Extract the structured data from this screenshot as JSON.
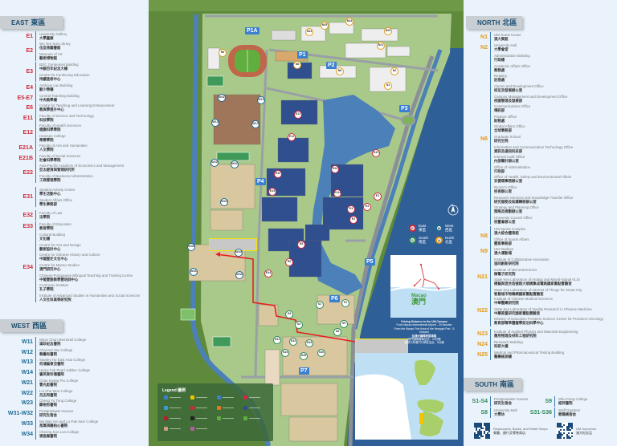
{
  "colors": {
    "east": "#d3283a",
    "west": "#1e6b94",
    "north": "#e59a16",
    "south": "#2e8a5a",
    "parking": "#3a7fd0",
    "route": "#e82020"
  },
  "east": {
    "title": "EAST",
    "title_zh": "東區",
    "groups": [
      {
        "code": "E1",
        "items": [
          {
            "en": "University Gallery",
            "zh": "大學畫廊"
          }
        ]
      },
      {
        "code": "E2",
        "items": [
          {
            "en": "Wu Yee Sun Library",
            "zh": "伍宜孫圖書館"
          },
          {
            "en": "Museum of Art",
            "zh": "藝術博物館"
          }
        ]
      },
      {
        "code": "E3",
        "items": [
          {
            "en": "BOC Centennial Building",
            "zh": "中銀百年紀念大樓"
          },
          {
            "en": "Centre for Continuing Education",
            "zh": "持續進修中心"
          }
        ]
      },
      {
        "code": "E4",
        "items": [
          {
            "en": "Anthony Lau Building",
            "zh": "劉少榮樓"
          }
        ]
      },
      {
        "code": "E5-E7",
        "items": [
          {
            "en": "Central Teaching Building",
            "zh": "中央教學樓"
          }
        ]
      },
      {
        "code": "E6",
        "items": [
          {
            "en": "Centre for Teaching and Learning Enhancement",
            "zh": "教與學提升中心"
          }
        ]
      },
      {
        "code": "E11",
        "items": [
          {
            "en": "Faculty of Science and Technology",
            "zh": "科技學院"
          }
        ]
      },
      {
        "code": "E12",
        "items": [
          {
            "en": "Faculty of Health Sciences",
            "zh": "健康科學學院"
          },
          {
            "en": "Honours College",
            "zh": "榮譽學院"
          }
        ]
      },
      {
        "code": "E21A",
        "items": [
          {
            "en": "Faculty of Arts and Humanities",
            "zh": "人文學院"
          }
        ]
      },
      {
        "code": "E21B",
        "items": [
          {
            "en": "Faculty of Social Sciences",
            "zh": "社會科學學院"
          }
        ]
      },
      {
        "code": "E22",
        "items": [
          {
            "en": "Asia-Pacific Academy of Economics and Management",
            "zh": "亞太經濟與管理研究所"
          },
          {
            "en": "Faculty of Business Administration",
            "zh": "工商管理學院"
          }
        ]
      },
      {
        "code": "E31",
        "items": [
          {
            "en": "Student Activity Centre",
            "zh": "學生活動中心"
          },
          {
            "en": "Student Affairs Office",
            "zh": "學生事務部"
          }
        ]
      },
      {
        "code": "E32",
        "items": [
          {
            "en": "Faculty of Law",
            "zh": "法學院"
          }
        ]
      },
      {
        "code": "E33",
        "items": [
          {
            "en": "Faculty of Education",
            "zh": "教育學院"
          }
        ]
      },
      {
        "code": "E34",
        "items": [
          {
            "en": "Cultural Building",
            "zh": "文化樓"
          },
          {
            "en": "Centre for Arts and Design",
            "zh": "藝術設計中心"
          },
          {
            "en": "Centre for Chinese History and Culture",
            "zh": "中國歷史文化中心"
          },
          {
            "en": "Centre for Macau Studies",
            "zh": "澳門研究中心"
          },
          {
            "en": "Chinese-Portuguese Bilingual Teaching and Training Centre",
            "zh": "中葡雙語教學暨培訓中心"
          },
          {
            "en": "Confucius Institute",
            "zh": "孔子學院"
          },
          {
            "en": "Institute of Advanced Studies in Humanities and Social Sciences",
            "zh": "人文社科高等研究院"
          }
        ]
      }
    ]
  },
  "west": {
    "title": "WEST",
    "title_zh": "西區",
    "groups": [
      {
        "code": "W11",
        "items": [
          {
            "en": "Moon Chun Memorial College",
            "zh": "滿珍紀念書院"
          }
        ]
      },
      {
        "code": "W12",
        "items": [
          {
            "en": "Choi Kai Yau College",
            "zh": "蔡繼有書院"
          }
        ]
      },
      {
        "code": "W13",
        "items": [
          {
            "en": "Stanley Ho East Asia College",
            "zh": "何鴻燊東亞書院"
          }
        ]
      },
      {
        "code": "W14",
        "items": [
          {
            "en": "Henry Fok Pearl Jubilee College",
            "zh": "霍英東珍禧書院"
          }
        ]
      },
      {
        "code": "W21",
        "items": [
          {
            "en": "Chao Kuang Piu College",
            "zh": "曹光彪書院"
          }
        ]
      },
      {
        "code": "W22",
        "items": [
          {
            "en": "Lui Che Woo College",
            "zh": "呂志和書院"
          }
        ]
      },
      {
        "code": "W23",
        "items": [
          {
            "en": "Cheng Yu Tung College",
            "zh": "鄭裕彤書院"
          }
        ]
      },
      {
        "code": "W31-W32",
        "items": [
          {
            "en": "Postgraduate Houses",
            "zh": "研究生宿舍"
          }
        ]
      },
      {
        "code": "W33",
        "items": [
          {
            "en": "Ma Man Kei and Lo Pak Sam College",
            "zh": "馬萬祺羅柏心書院"
          }
        ]
      },
      {
        "code": "W34",
        "items": [
          {
            "en": "Cheong Kun Lun College",
            "zh": "張崑崙書院"
          }
        ]
      }
    ]
  },
  "north": {
    "title": "NORTH",
    "title_zh": "北區",
    "groups": [
      {
        "code": "N1",
        "items": [
          {
            "en": "UM Guest House",
            "zh": "澳大賓館"
          }
        ]
      },
      {
        "code": "N2",
        "items": [
          {
            "en": "University Hall",
            "zh": "大學會堂"
          }
        ]
      },
      {
        "code": "N6",
        "items": [
          {
            "en": "Administration Building",
            "zh": "行政樓"
          },
          {
            "en": "Academic Affairs Office",
            "zh": "教務處"
          },
          {
            "en": "Registry",
            "zh": "註冊處"
          },
          {
            "en": "Alumni and Development Office",
            "zh": "校友及發展辦公室"
          },
          {
            "en": "Campus Management and Development Office",
            "zh": "校園管理及發展部"
          },
          {
            "en": "Communications Office",
            "zh": "傳訊部"
          },
          {
            "en": "Finance Office",
            "zh": "財務處"
          },
          {
            "en": "Global Affairs Office",
            "zh": "全球事務部"
          },
          {
            "en": "Graduate School",
            "zh": "研究生院"
          },
          {
            "en": "Information and Communication Technology Office",
            "zh": "資訊及通訊科技部"
          },
          {
            "en": "Internal Audit Office",
            "zh": "內部審計辦公室"
          },
          {
            "en": "Office of Administration",
            "zh": "行政部"
          },
          {
            "en": "Office of Health, Safety and Environmental Affairs",
            "zh": "安健環事務辦公室"
          },
          {
            "en": "Rector's Office",
            "zh": "校長辦公室"
          },
          {
            "en": "Research Services and Knowledge Transfer Office",
            "zh": "研究服務及知識轉移辦公室"
          },
          {
            "en": "Strategy and Planning Office",
            "zh": "策略及規劃辦公室"
          },
          {
            "en": "University Council Office",
            "zh": "校董會辦公室"
          }
        ]
      },
      {
        "code": "N8",
        "items": [
          {
            "en": "UM Sports Complex",
            "zh": "澳大綜合體育館"
          },
          {
            "en": "Office of Sports Affairs",
            "zh": "體育事務部"
          }
        ]
      },
      {
        "code": "N9",
        "items": [
          {
            "en": "UM Stadium",
            "zh": "澳大運動場"
          }
        ]
      },
      {
        "code": "N21",
        "items": [
          {
            "en": "Institute of Collaborative Innovation",
            "zh": "協同創新研究院"
          },
          {
            "en": "Institute of Microelectronics",
            "zh": "微電子研究院"
          },
          {
            "en": "State Key Laboratory of Analog and Mixed-Signal VLSI",
            "zh": "模擬與混合信號超大規模集成電路國家重點實驗室"
          },
          {
            "en": "State Key Laboratory of Internet of Things for Smart City",
            "zh": "智慧城市物聯網國家重點實驗室"
          }
        ]
      },
      {
        "code": "N22",
        "items": [
          {
            "en": "Institute of Chinese Medical Sciences",
            "zh": "中華醫藥研究院"
          },
          {
            "en": "State Key Laboratory of Quality Research in Chinese Medicine",
            "zh": "中藥質量研究國家重點實驗室"
          },
          {
            "en": "Ministry of Education Frontiers Science Center for Precision Oncology",
            "zh": "教育部精準腫瘤學前沿科學中心"
          }
        ]
      },
      {
        "code": "N23",
        "items": [
          {
            "en": "Institute of Applied Physics and Materials Engineering",
            "zh": "應用物理及材料工程研究院"
          }
        ]
      },
      {
        "code": "N24",
        "items": [
          {
            "en": "Research Building",
            "zh": "科研大樓"
          }
        ]
      },
      {
        "code": "N25",
        "items": [
          {
            "en": "Medical and Pharmaceutical Testing Building",
            "zh": "醫藥檢測樓"
          }
        ]
      }
    ]
  },
  "south": {
    "title": "SOUTH",
    "title_zh": "南區",
    "groups": [
      {
        "code": "S1-S4",
        "items": [
          {
            "en": "Postgraduate Houses",
            "zh": "研究生宿舍"
          }
        ]
      },
      {
        "code": "S9",
        "items": [
          {
            "en": "Shiu Pong College",
            "zh": "紹邦書院"
          }
        ]
      },
      {
        "code": "S8",
        "items": [
          {
            "en": "University Mall",
            "zh": "大學坊"
          }
        ]
      },
      {
        "code": "S31-S36",
        "items": [
          {
            "en": "Staff Quarters",
            "zh": "教職員宿舍"
          }
        ]
      }
    ],
    "qr": [
      {
        "en": "Restaurants, Banks, and Retail Shops",
        "zh": "餐廳、銀行及零售商店"
      },
      {
        "en": "UM Souvenirs",
        "zh": "澳大紀念品"
      }
    ]
  },
  "map": {
    "parking": [
      "P1A",
      "P1",
      "P2",
      "P3",
      "P4",
      "P5",
      "P6",
      "P7"
    ],
    "markers": [
      {
        "label": "N25",
        "zone": "north"
      },
      {
        "label": "N24",
        "zone": "north"
      },
      {
        "label": "N23",
        "zone": "north"
      },
      {
        "label": "N22",
        "zone": "north"
      },
      {
        "label": "N21",
        "zone": "north"
      },
      {
        "label": "N9",
        "zone": "north"
      },
      {
        "label": "N8",
        "zone": "north"
      },
      {
        "label": "N6",
        "zone": "north"
      },
      {
        "label": "N2",
        "zone": "north"
      },
      {
        "label": "N1",
        "zone": "north"
      },
      {
        "label": "W11",
        "zone": "west"
      },
      {
        "label": "W12",
        "zone": "west"
      },
      {
        "label": "W13",
        "zone": "west"
      },
      {
        "label": "W14",
        "zone": "west"
      },
      {
        "label": "W21",
        "zone": "west"
      },
      {
        "label": "W22",
        "zone": "west"
      },
      {
        "label": "W23",
        "zone": "west"
      },
      {
        "label": "W33",
        "zone": "west"
      },
      {
        "label": "W34",
        "zone": "west"
      },
      {
        "label": "W31",
        "zone": "west"
      },
      {
        "label": "W32",
        "zone": "west"
      },
      {
        "label": "E11",
        "zone": "east"
      },
      {
        "label": "E12",
        "zone": "east"
      },
      {
        "label": "E31",
        "zone": "east"
      },
      {
        "label": "E32",
        "zone": "east"
      },
      {
        "label": "E33",
        "zone": "east"
      },
      {
        "label": "E22",
        "zone": "east"
      },
      {
        "label": "E21A",
        "zone": "east"
      },
      {
        "label": "E1",
        "zone": "east"
      },
      {
        "label": "E4",
        "zone": "east"
      },
      {
        "label": "E3",
        "zone": "east"
      },
      {
        "label": "E2",
        "zone": "east"
      },
      {
        "label": "E34",
        "zone": "east"
      },
      {
        "label": "E5",
        "zone": "east"
      },
      {
        "label": "E6",
        "zone": "east"
      },
      {
        "label": "S1",
        "zone": "south"
      },
      {
        "label": "S2",
        "zone": "south"
      },
      {
        "label": "S3",
        "zone": "south"
      },
      {
        "label": "S4",
        "zone": "south"
      },
      {
        "label": "S8",
        "zone": "south"
      },
      {
        "label": "S9",
        "zone": "south"
      },
      {
        "label": "S31",
        "zone": "south"
      },
      {
        "label": "S32",
        "zone": "south"
      },
      {
        "label": "S33",
        "zone": "south"
      },
      {
        "label": "S34",
        "zone": "south"
      },
      {
        "label": "S35",
        "zone": "south"
      },
      {
        "label": "S36",
        "zone": "south"
      }
    ],
    "zone_key": [
      {
        "letter": "E",
        "en": "East",
        "zh": "東區",
        "zone": "east"
      },
      {
        "letter": "W",
        "en": "West",
        "zh": "西區",
        "zone": "west"
      },
      {
        "letter": "S",
        "en": "South",
        "zh": "南區",
        "zone": "south"
      },
      {
        "letter": "N",
        "en": "North",
        "zh": "北區",
        "zone": "north"
      }
    ],
    "inset": {
      "en": "Macao",
      "zh": "澳門"
    },
    "driving": {
      "title": "Driving Distance to the UM Campus",
      "line1": "From Macau International Airport - 20 minutes",
      "line2": "From the Macau Port Area of the Hengqin Port - 5 minutes",
      "title_zh": "往澳大橫琴校區車程",
      "line1_zh": "澳門國際機場至此：20分鐘",
      "line2_zh": "橫琴口岸澳門口岸區至此：5分鐘"
    },
    "compass": "N",
    "legend_title": "Legend 圖例"
  }
}
